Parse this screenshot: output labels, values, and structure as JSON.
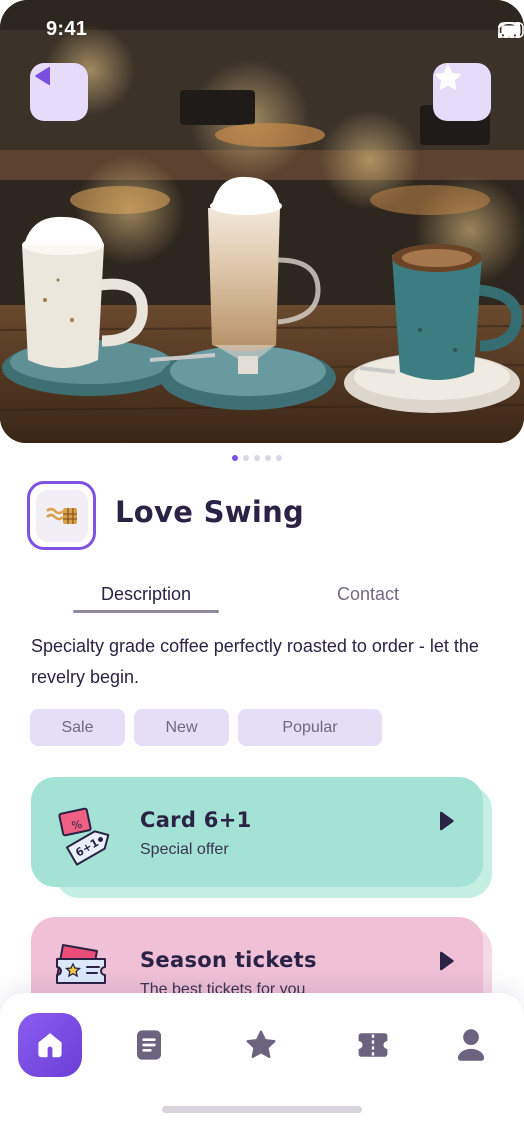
{
  "status_bar": {
    "time": "9:41"
  },
  "hero": {
    "back_icon": "back-icon",
    "favorite_icon": "star-icon",
    "carousel": {
      "count": 5,
      "active_index": 0
    }
  },
  "shop": {
    "name": "Love Swing",
    "logo_icon": "waffle-logo"
  },
  "tabs": [
    {
      "label": "Description",
      "active": true
    },
    {
      "label": "Contact",
      "active": false
    }
  ],
  "description": "Specialty grade coffee perfectly roasted to order - let the revelry begin.",
  "tags": [
    "Sale",
    "New",
    "Popular"
  ],
  "offers": [
    {
      "title": "Card 6+1",
      "subtitle": "Special offer",
      "icon": "discount-tag-icon",
      "tag_text": "6+1",
      "color": "#a3e2d4"
    },
    {
      "title": "Season tickets",
      "subtitle": "The best tickets for you",
      "icon": "ticket-icon",
      "color": "#efc0d6"
    }
  ],
  "nav": [
    {
      "icon": "home-icon",
      "active": true
    },
    {
      "icon": "document-icon",
      "active": false
    },
    {
      "icon": "star-icon",
      "active": false
    },
    {
      "icon": "ticket-icon",
      "active": false
    },
    {
      "icon": "profile-icon",
      "active": false
    }
  ],
  "colors": {
    "accent": "#7e52e3",
    "text": "#2b2346",
    "tag_bg": "#e6ddf7",
    "nav_icon": "#6c6380"
  }
}
